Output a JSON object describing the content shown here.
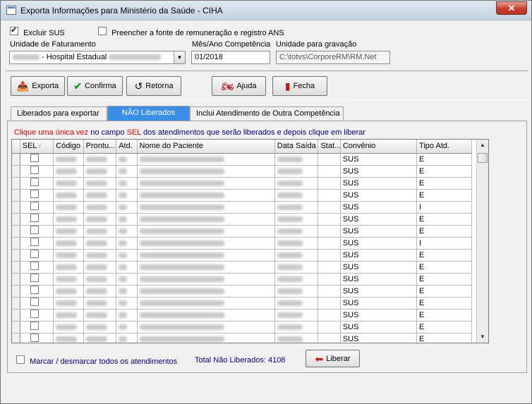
{
  "window": {
    "title": "Exporta Informações para Ministério da Saúde - CIHA",
    "close_label": "✕"
  },
  "options": {
    "excluir_sus": {
      "label": "Excluir SUS",
      "checked": true
    },
    "preencher_fonte": {
      "label": "Preencher a fonte de remuneração e registro ANS",
      "checked": false
    }
  },
  "fields": {
    "unidade_faturamento": {
      "label": "Unidade de Faturamento",
      "value": " - Hospital Estadual "
    },
    "mes_ano": {
      "label": "Mês/Ano Competência",
      "value": "01/2018"
    },
    "unidade_gravacao": {
      "label": "Unidade para gravação",
      "value": "C:\\totvs\\CorporeRM\\RM.Net"
    }
  },
  "toolbar": {
    "exporta": "Exporta",
    "confirma": "Confirma",
    "retorna": "Retorna",
    "ajuda": "Ajuda",
    "fecha": "Fecha"
  },
  "tabs": [
    {
      "label": "Liberados para exportar"
    },
    {
      "label": "NÃO Liberados"
    },
    {
      "label": "Inclui Atendimento de Outra Competência"
    }
  ],
  "instructions": {
    "p1": "Clique uma única vez",
    "p2": " no campo ",
    "p3": "SEL",
    "p4": " dos atendimentos que serão liberados e depois clique em liberar"
  },
  "grid": {
    "columns": [
      "SEL",
      "Código",
      "Prontu...",
      "Atd.",
      "Nome do Paciente",
      "Data Saída",
      "Stat...",
      "Convênio",
      "Tipo Atd."
    ],
    "rows": [
      {
        "convenio": "SUS",
        "tipo": "E"
      },
      {
        "convenio": "SUS",
        "tipo": "E"
      },
      {
        "convenio": "SUS",
        "tipo": "E"
      },
      {
        "convenio": "SUS",
        "tipo": "E"
      },
      {
        "convenio": "SUS",
        "tipo": "I"
      },
      {
        "convenio": "SUS",
        "tipo": "E"
      },
      {
        "convenio": "SUS",
        "tipo": "E"
      },
      {
        "convenio": "SUS",
        "tipo": "I"
      },
      {
        "convenio": "SUS",
        "tipo": "E"
      },
      {
        "convenio": "SUS",
        "tipo": "E"
      },
      {
        "convenio": "SUS",
        "tipo": "E"
      },
      {
        "convenio": "SUS",
        "tipo": "E"
      },
      {
        "convenio": "SUS",
        "tipo": "E"
      },
      {
        "convenio": "SUS",
        "tipo": "E"
      },
      {
        "convenio": "SUS",
        "tipo": "E"
      },
      {
        "convenio": "SUS",
        "tipo": "E"
      }
    ]
  },
  "footer": {
    "marcar_label": "Marcar / desmarcar todos os atendimentos",
    "total_label": "Total Não Liberados: 4108",
    "liberar": "Liberar"
  }
}
